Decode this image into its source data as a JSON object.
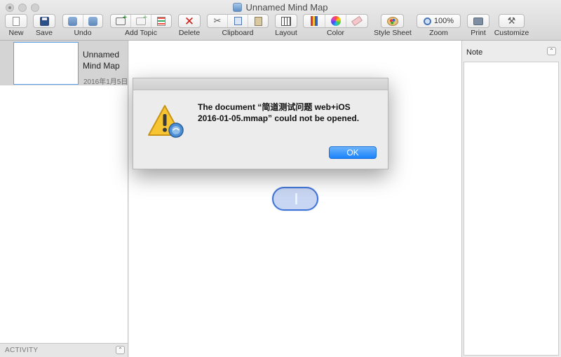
{
  "window": {
    "title": "Unnamed Mind Map"
  },
  "toolbar": {
    "new": "New",
    "save": "Save",
    "undo": "Undo",
    "add_topic": "Add Topic",
    "delete": "Delete",
    "clipboard": "Clipboard",
    "layout": "Layout",
    "color": "Color",
    "style_sheet": "Style Sheet",
    "zoom": "Zoom",
    "zoom_level": "100%",
    "print": "Print",
    "customize": "Customize"
  },
  "sidebar": {
    "sheet_name": "Unnamed Mind Map",
    "sheet_date": "2016年1月5日",
    "activity_label": "ACTIVITY"
  },
  "note": {
    "title": "Note"
  },
  "dialog": {
    "message": "The document “简道测试问题 web+iOS 2016-01-05.mmap” could not be opened.",
    "ok": "OK"
  }
}
